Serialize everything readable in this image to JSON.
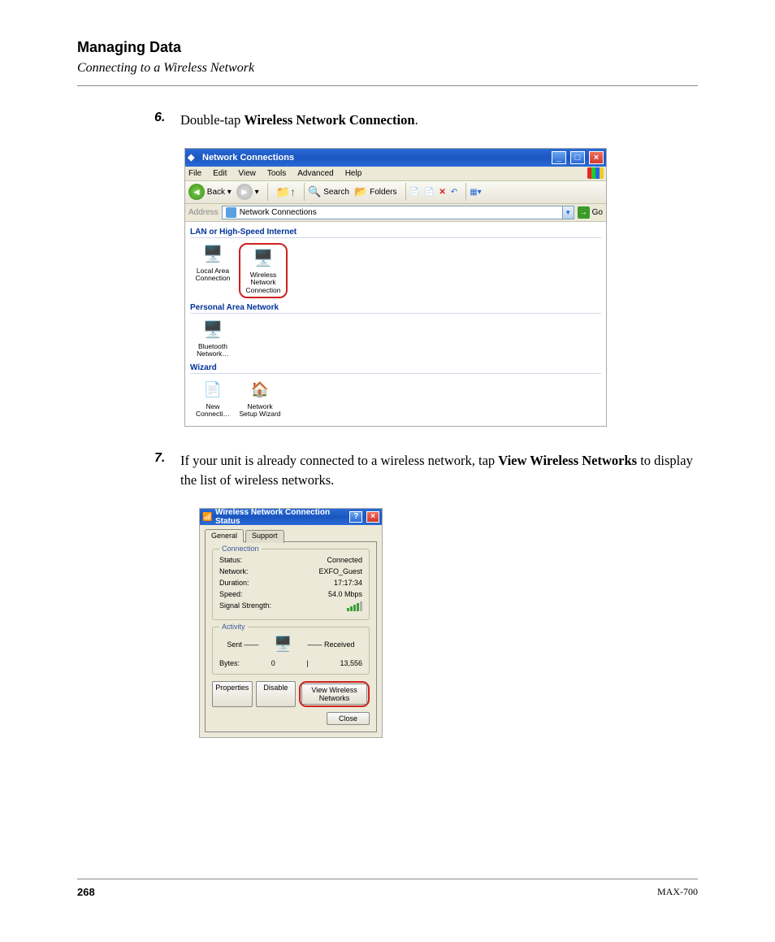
{
  "header": {
    "chapter": "Managing Data",
    "section": "Connecting to a Wireless Network"
  },
  "steps": {
    "s6": {
      "num": "6.",
      "pre": "Double-tap ",
      "bold": "Wireless Network Connection",
      "post": "."
    },
    "s7": {
      "num": "7.",
      "pre": "If your unit is already connected to a wireless network, tap ",
      "bold1": "View Wireless Networks",
      "post": " to display the list of wireless networks."
    }
  },
  "shot1": {
    "title": "Network Connections",
    "menu": {
      "file": "File",
      "edit": "Edit",
      "view": "View",
      "tools": "Tools",
      "adv": "Advanced",
      "help": "Help"
    },
    "toolbar": {
      "back": "Back",
      "search": "Search",
      "folders": "Folders"
    },
    "address": {
      "label": "Address",
      "value": "Network Connections",
      "go": "Go"
    },
    "cats": {
      "lan": "LAN or High-Speed Internet",
      "pan": "Personal Area Network",
      "wiz": "Wizard"
    },
    "icons": {
      "lac": "Local Area Connection",
      "wnc_l1": "Wireless",
      "wnc_l2": "Network",
      "wnc_l3": "Connection",
      "bt": "Bluetooth Network…",
      "nc": "New Connecti…",
      "nsw": "Network Setup Wizard"
    }
  },
  "shot2": {
    "title": "Wireless Network Connection Status",
    "tabs": {
      "general": "General",
      "support": "Support"
    },
    "conn": {
      "legend": "Connection",
      "status_l": "Status:",
      "status_v": "Connected",
      "network_l": "Network:",
      "network_v": "EXFO_Guest",
      "duration_l": "Duration:",
      "duration_v": "17:17:34",
      "speed_l": "Speed:",
      "speed_v": "54.0 Mbps",
      "signal_l": "Signal Strength:"
    },
    "act": {
      "legend": "Activity",
      "sent": "Sent",
      "recv": "Received",
      "bytes_l": "Bytes:",
      "bytes_sent": "0",
      "bytes_recv": "13,556"
    },
    "buttons": {
      "props": "Properties",
      "disable": "Disable",
      "view": "View Wireless Networks",
      "close": "Close"
    }
  },
  "footer": {
    "page": "268",
    "model": "MAX-700"
  }
}
